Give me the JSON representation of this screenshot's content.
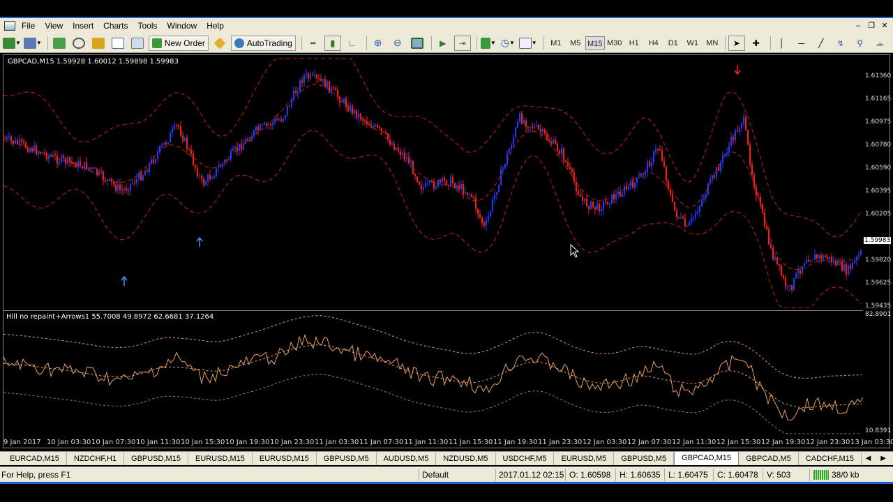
{
  "menu": [
    "File",
    "View",
    "Insert",
    "Charts",
    "Tools",
    "Window",
    "Help"
  ],
  "toolbar": {
    "new_order": "New Order",
    "autotrading": "AutoTrading",
    "timeframes": [
      "M1",
      "M5",
      "M15",
      "M30",
      "H1",
      "H4",
      "D1",
      "W1",
      "MN"
    ],
    "active_timeframe": "M15"
  },
  "chart": {
    "label": "GBPCAD,M15  1.59928 1.60012 1.59898 1.59983",
    "price_ticks": [
      "1.61360",
      "1.61165",
      "1.60975",
      "1.60780",
      "1.60590",
      "1.60395",
      "1.60205",
      "1.59983",
      "1.59820",
      "1.59625",
      "1.59435"
    ],
    "current_price": "1.59983",
    "indicator_label": "Hill no repaint+Arrows1 55.7008 49.8972 62.6681 37.1264",
    "indicator_max": "82.8901",
    "indicator_min": "10.8391",
    "time_ticks": [
      "9 Jan 2017",
      "10 Jan 03:30",
      "10 Jan 07:30",
      "10 Jan 11:30",
      "10 Jan 15:30",
      "10 Jan 19:30",
      "10 Jan 23:30",
      "11 Jan 03:30",
      "11 Jan 07:30",
      "11 Jan 11:30",
      "11 Jan 15:30",
      "11 Jan 19:30",
      "11 Jan 23:30",
      "12 Jan 03:30",
      "12 Jan 07:30",
      "12 Jan 11:30",
      "12 Jan 15:30",
      "12 Jan 19:30",
      "12 Jan 23:30",
      "13 Jan 03:30"
    ],
    "colors": {
      "bull": "#1f3bff",
      "bear": "#ff1a1a",
      "bands": "#cc1b1b",
      "indicator": "#e8a060",
      "ind_band_upper": "#e8a060",
      "ind_band_lower": "#5fa05f",
      "arrow_up": "#4a8fff",
      "arrow_down": "#ff2a2a"
    }
  },
  "tabs": [
    "EURCAD,M15",
    "NZDCHF,H1",
    "GBPUSD,M15",
    "EURUSD,M15",
    "EURUSD,M15",
    "GBPUSD,M5",
    "AUDUSD,M5",
    "NZDUSD,M5",
    "USDCHF,M5",
    "EURUSD,M5",
    "GBPUSD,M5",
    "GBPCAD,M15",
    "GBPCAD,M5",
    "CADCHF,M15"
  ],
  "active_tab": "GBPCAD,M15",
  "status": {
    "help": "For Help, press F1",
    "profile": "Default",
    "datetime": "2017.01.12 02:15",
    "open": "O: 1.60598",
    "high": "H: 1.60635",
    "low": "L: 1.60475",
    "close": "C: 1.60478",
    "volume": "V: 503",
    "traffic": "38/0 kb"
  }
}
